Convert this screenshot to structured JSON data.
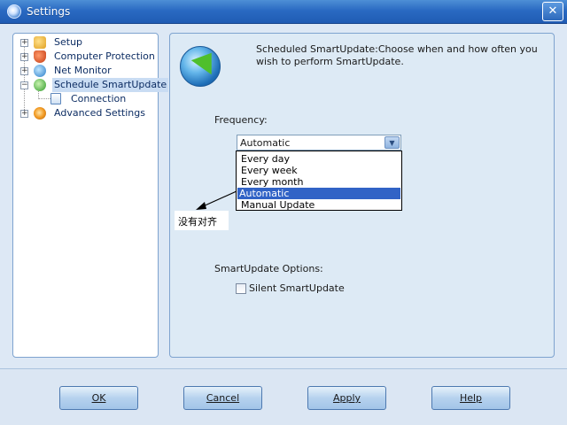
{
  "window": {
    "title": "Settings",
    "close_glyph": "✕"
  },
  "tree": {
    "items": [
      {
        "label": "Setup",
        "icon": "setup-icon"
      },
      {
        "label": "Computer Protection",
        "icon": "shield-icon"
      },
      {
        "label": "Net Monitor",
        "icon": "network-icon"
      },
      {
        "label": "Schedule SmartUpdate",
        "icon": "update-icon",
        "selected": true
      },
      {
        "label": "Connection",
        "icon": "document-icon",
        "child": true
      },
      {
        "label": "Advanced Settings",
        "icon": "gear-icon"
      }
    ],
    "expander_glyph": "+",
    "collapse_glyph": "−"
  },
  "content": {
    "description": "Scheduled SmartUpdate:Choose when and how often you wish to perform SmartUpdate.",
    "frequency_label": "Frequency:",
    "frequency_selected": "Automatic",
    "dropdown_arrow": "▼",
    "frequency_options": [
      "Every day",
      "Every week",
      "Every month",
      "Automatic",
      "Manual Update"
    ],
    "annotation": "没有对齐",
    "options_label": "SmartUpdate Options:",
    "silent_label": "Silent SmartUpdate"
  },
  "buttons": {
    "ok": "OK",
    "cancel": "Cancel",
    "apply": "Apply",
    "help": "Help"
  }
}
